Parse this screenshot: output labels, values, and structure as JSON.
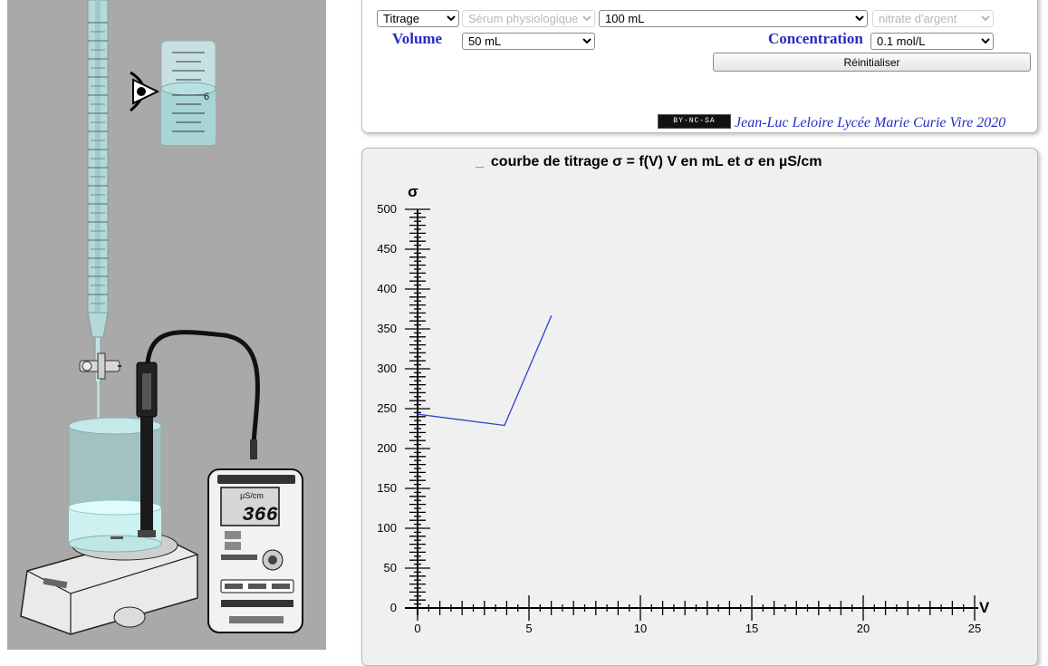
{
  "controls": {
    "mode": {
      "selected": "Titrage",
      "options": [
        "Titrage"
      ]
    },
    "solution": {
      "selected": "Sérum physiologique",
      "disabled": true
    },
    "beaker_volume": {
      "selected": "100 mL"
    },
    "reagent": {
      "selected": "nitrate d'argent",
      "disabled": true
    },
    "volume_label": "Volume",
    "volume": {
      "selected": "50 mL"
    },
    "concentration_label": "Concentration",
    "concentration": {
      "selected": "0.1 mol/L"
    },
    "reset_label": "Réinitialiser"
  },
  "credit": {
    "badge": "BY-NC-SA",
    "text": "Jean-Luc Leloire Lycée Marie Curie Vire 2020"
  },
  "lab": {
    "cylinder_reading": "6",
    "meter_unit": "µS/cm",
    "meter_value": "366"
  },
  "chart_data": {
    "type": "line",
    "title": "courbe de titrage σ = f(V) V en mL et σ en µS/cm",
    "xlabel": "V",
    "ylabel": "σ",
    "xlim": [
      0,
      25
    ],
    "ylim": [
      0,
      500
    ],
    "x_ticks": [
      0,
      5,
      10,
      15,
      20,
      25
    ],
    "y_ticks": [
      0,
      50,
      100,
      150,
      200,
      250,
      300,
      350,
      400,
      450,
      500
    ],
    "series": [
      {
        "color": "#2b3fd6",
        "x": [
          0,
          3.9,
          6.0
        ],
        "y": [
          243,
          229,
          366
        ]
      }
    ]
  }
}
